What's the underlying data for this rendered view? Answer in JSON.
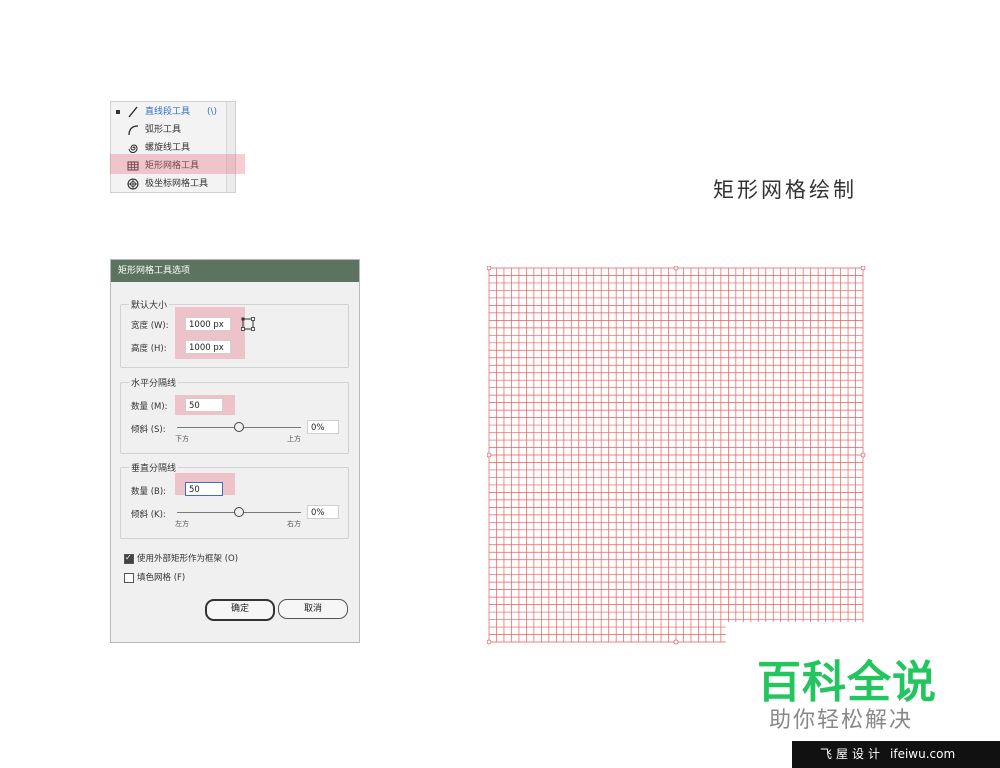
{
  "tool_menu": {
    "items": [
      {
        "label": "直线段工具",
        "shortcut": "(\\)",
        "icon": "line-segment-icon",
        "active": true
      },
      {
        "label": "弧形工具",
        "shortcut": "",
        "icon": "arc-icon",
        "active": false
      },
      {
        "label": "螺旋线工具",
        "shortcut": "",
        "icon": "spiral-icon",
        "active": false
      },
      {
        "label": "矩形网格工具",
        "shortcut": "",
        "icon": "rectangular-grid-icon",
        "active": false
      },
      {
        "label": "极坐标网格工具",
        "shortcut": "",
        "icon": "polar-grid-icon",
        "active": false
      }
    ],
    "highlighted_index": 3
  },
  "page_title": "矩形网格绘制",
  "dialog": {
    "title": "矩形网格工具选项",
    "default_size": {
      "label": "默认大小",
      "width_label": "宽度 (W):",
      "width_value": "1000 px",
      "height_label": "高度 (H):",
      "height_value": "1000 px"
    },
    "horizontal_dividers": {
      "label": "水平分隔线",
      "count_label": "数量 (M):",
      "count_value": "50",
      "skew_label": "倾斜 (S):",
      "skew_value": "0%",
      "left_tick": "下方",
      "right_tick": "上方"
    },
    "vertical_dividers": {
      "label": "垂直分隔线",
      "count_label": "数量 (B):",
      "count_value": "50",
      "skew_label": "倾斜 (K):",
      "skew_value": "0%",
      "left_tick": "左方",
      "right_tick": "右方"
    },
    "use_outer_rect": {
      "label": "使用外部矩形作为框架 (O)",
      "checked": true
    },
    "fill_grid": {
      "label": "填色网格 (F)",
      "checked": false
    },
    "ok_label": "确定",
    "cancel_label": "取消"
  },
  "grid": {
    "rows": 50,
    "cols": 50,
    "line_color": "#ee5a5a"
  },
  "watermark": {
    "brand": "百科全说",
    "slogan": "助你轻松解决",
    "brand_color": "#22c55e"
  },
  "footer": {
    "text": "飞屋设计",
    "url": "ifeiwu.com"
  }
}
